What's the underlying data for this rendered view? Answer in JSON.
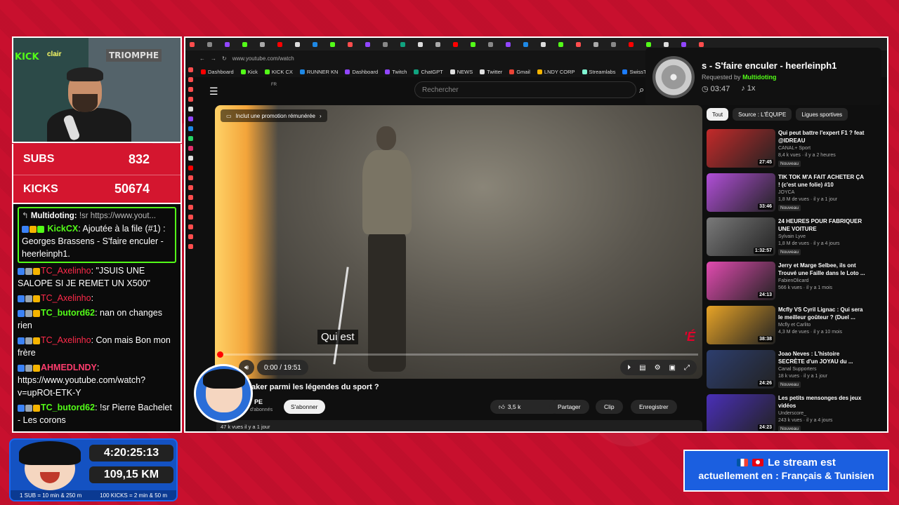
{
  "webcam": {
    "sign_kick": "KICK",
    "sign_clair": "clair",
    "sign_triomphe": "TRIOMPHE"
  },
  "counters": {
    "subs_label": "SUBS",
    "subs_value": "832",
    "kicks_label": "KICKS",
    "kicks_value": "50674"
  },
  "chat": {
    "highlight": {
      "reply_user": "Multidoting:",
      "reply_text": "!sr https://www.yout...",
      "user": "KickCX",
      "text": ": Ajoutée à la file (#1) : Georges Brassens - S'faire enculer - heerleinph1."
    },
    "messages": [
      {
        "user": "TC_Axelinho",
        "text": ": \"JSUIS UNE SALOPE SI JE REMET UN X500\"",
        "style": "u-red"
      },
      {
        "user": "TC_Axelinho",
        "text": ":",
        "style": "u-red"
      },
      {
        "user": "TC_butord62",
        "text": ": nan on changes rien",
        "style": "u-green"
      },
      {
        "user": "TC_Axelinho",
        "text": ": Con mais Bon mon frère",
        "style": "u-red"
      },
      {
        "user": "AHMEDLNDY",
        "text": ": https://www.youtube.com/watch?v=upROt-ETK-Y",
        "style": "u-pink"
      },
      {
        "user": "TC_butord62",
        "text": ": !sr Pierre Bachelet - Les corons",
        "style": "u-green"
      }
    ]
  },
  "browser": {
    "url": "www.youtube.com/watch",
    "bookmarks": [
      "Dashboard",
      "Kick",
      "KICK CX",
      "RUNNER KN",
      "Dashboard",
      "Twitch",
      "ChatGPT",
      "NEWS",
      "Twitter",
      "Gmail",
      "LNDY CORP",
      "Streamlabs",
      "SwissTransfer"
    ],
    "bookmark_colors": [
      "#ff0000",
      "#53fc18",
      "#53fc18",
      "#1e88e5",
      "#9146ff",
      "#9146ff",
      "#10a37f",
      "#e0e0e0",
      "#e0e0e0",
      "#ea4335",
      "#f5b400",
      "#80f5d2",
      "#1c7cff"
    ]
  },
  "youtube": {
    "fr": "FR",
    "search_placeholder": "Rechercher",
    "promo": "Inclut une promotion rémunérée",
    "caption": "Qui est",
    "watermark": "'É",
    "time": "0:00 / 19:51",
    "title": "aker parmi les légendes du sport ?",
    "channel": "PE",
    "channel_subs": "d'abonnés",
    "subscribe": "S'abonner",
    "likes": "3,5 k",
    "share": "Partager",
    "clip": "Clip",
    "save": "Enregistrer",
    "views_line": "47 k vues  il y a 1 jour"
  },
  "nowplaying": {
    "title": "s - S'faire enculer - heerleinph1",
    "requested_prefix": "Requested by",
    "requested_user": "Multidoting",
    "time": "03:47",
    "speed": "1x"
  },
  "chips": [
    "Tout",
    "Source : L'ÉQUIPE",
    "Ligues sportives"
  ],
  "recs": [
    {
      "title": "Qui peut battre l'expert F1 ? feat @IDREAU",
      "channel": "CANAL+ Sport",
      "views": "8,4 k vues · il y a 2 heures",
      "duration": "27:45",
      "new": "Nouveau",
      "color": "#c42a2a"
    },
    {
      "title": "TIK TOK M'A FAIT ACHETER ÇA ! (c'est une folie) #10",
      "channel": "JOYCA",
      "views": "1,8 M de vues · il y a 1 jour",
      "duration": "33:46",
      "new": "Nouveau",
      "color": "#b14fd8"
    },
    {
      "title": "24 HEURES POUR FABRIQUER UNE VOITURE",
      "channel": "Sylvain Lyve",
      "views": "1,8 M de vues · il y a 4 jours",
      "duration": "1:32:57",
      "new": "Nouveau",
      "color": "#7a7a7a"
    },
    {
      "title": "Jerry et Marge Selbee, ils ont Trouvé une Faille dans le Loto ...",
      "channel": "FabienOlicard",
      "views": "566 k vues · il y a 1 mois",
      "duration": "24:13",
      "new": "",
      "color": "#e24bb0"
    },
    {
      "title": "Mcfly VS Cyril Lignac : Qui sera le meilleur goûteur ? (Duel ...",
      "channel": "Mcfly et Carlito",
      "views": "4,3 M de vues · il y a 10 mois",
      "duration": "38:38",
      "new": "",
      "color": "#e8a427"
    },
    {
      "title": "Joao Neves : L'histoire SECRÈTE d'un JOYAU du ...",
      "channel": "Canal Supporters",
      "views": "18 k vues · il y a 1 jour",
      "duration": "24:26",
      "new": "Nouveau",
      "color": "#2d3e6e"
    },
    {
      "title": "Les petits mensonges des jeux vidéos",
      "channel": "Underscore_",
      "views": "243 k vues · il y a 4 jours",
      "duration": "24:23",
      "new": "Nouveau",
      "color": "#4a2fb8"
    }
  ],
  "stats": {
    "time": "4:20:25:13",
    "km": "109,15 KM",
    "footer_left": "1 SUB = 10 min & 250 m",
    "footer_right": "100 KICKS = 2 min & 50 m"
  },
  "lang": {
    "line1": "Le stream est",
    "line2": "actuellement en : Français & Tunisien"
  }
}
